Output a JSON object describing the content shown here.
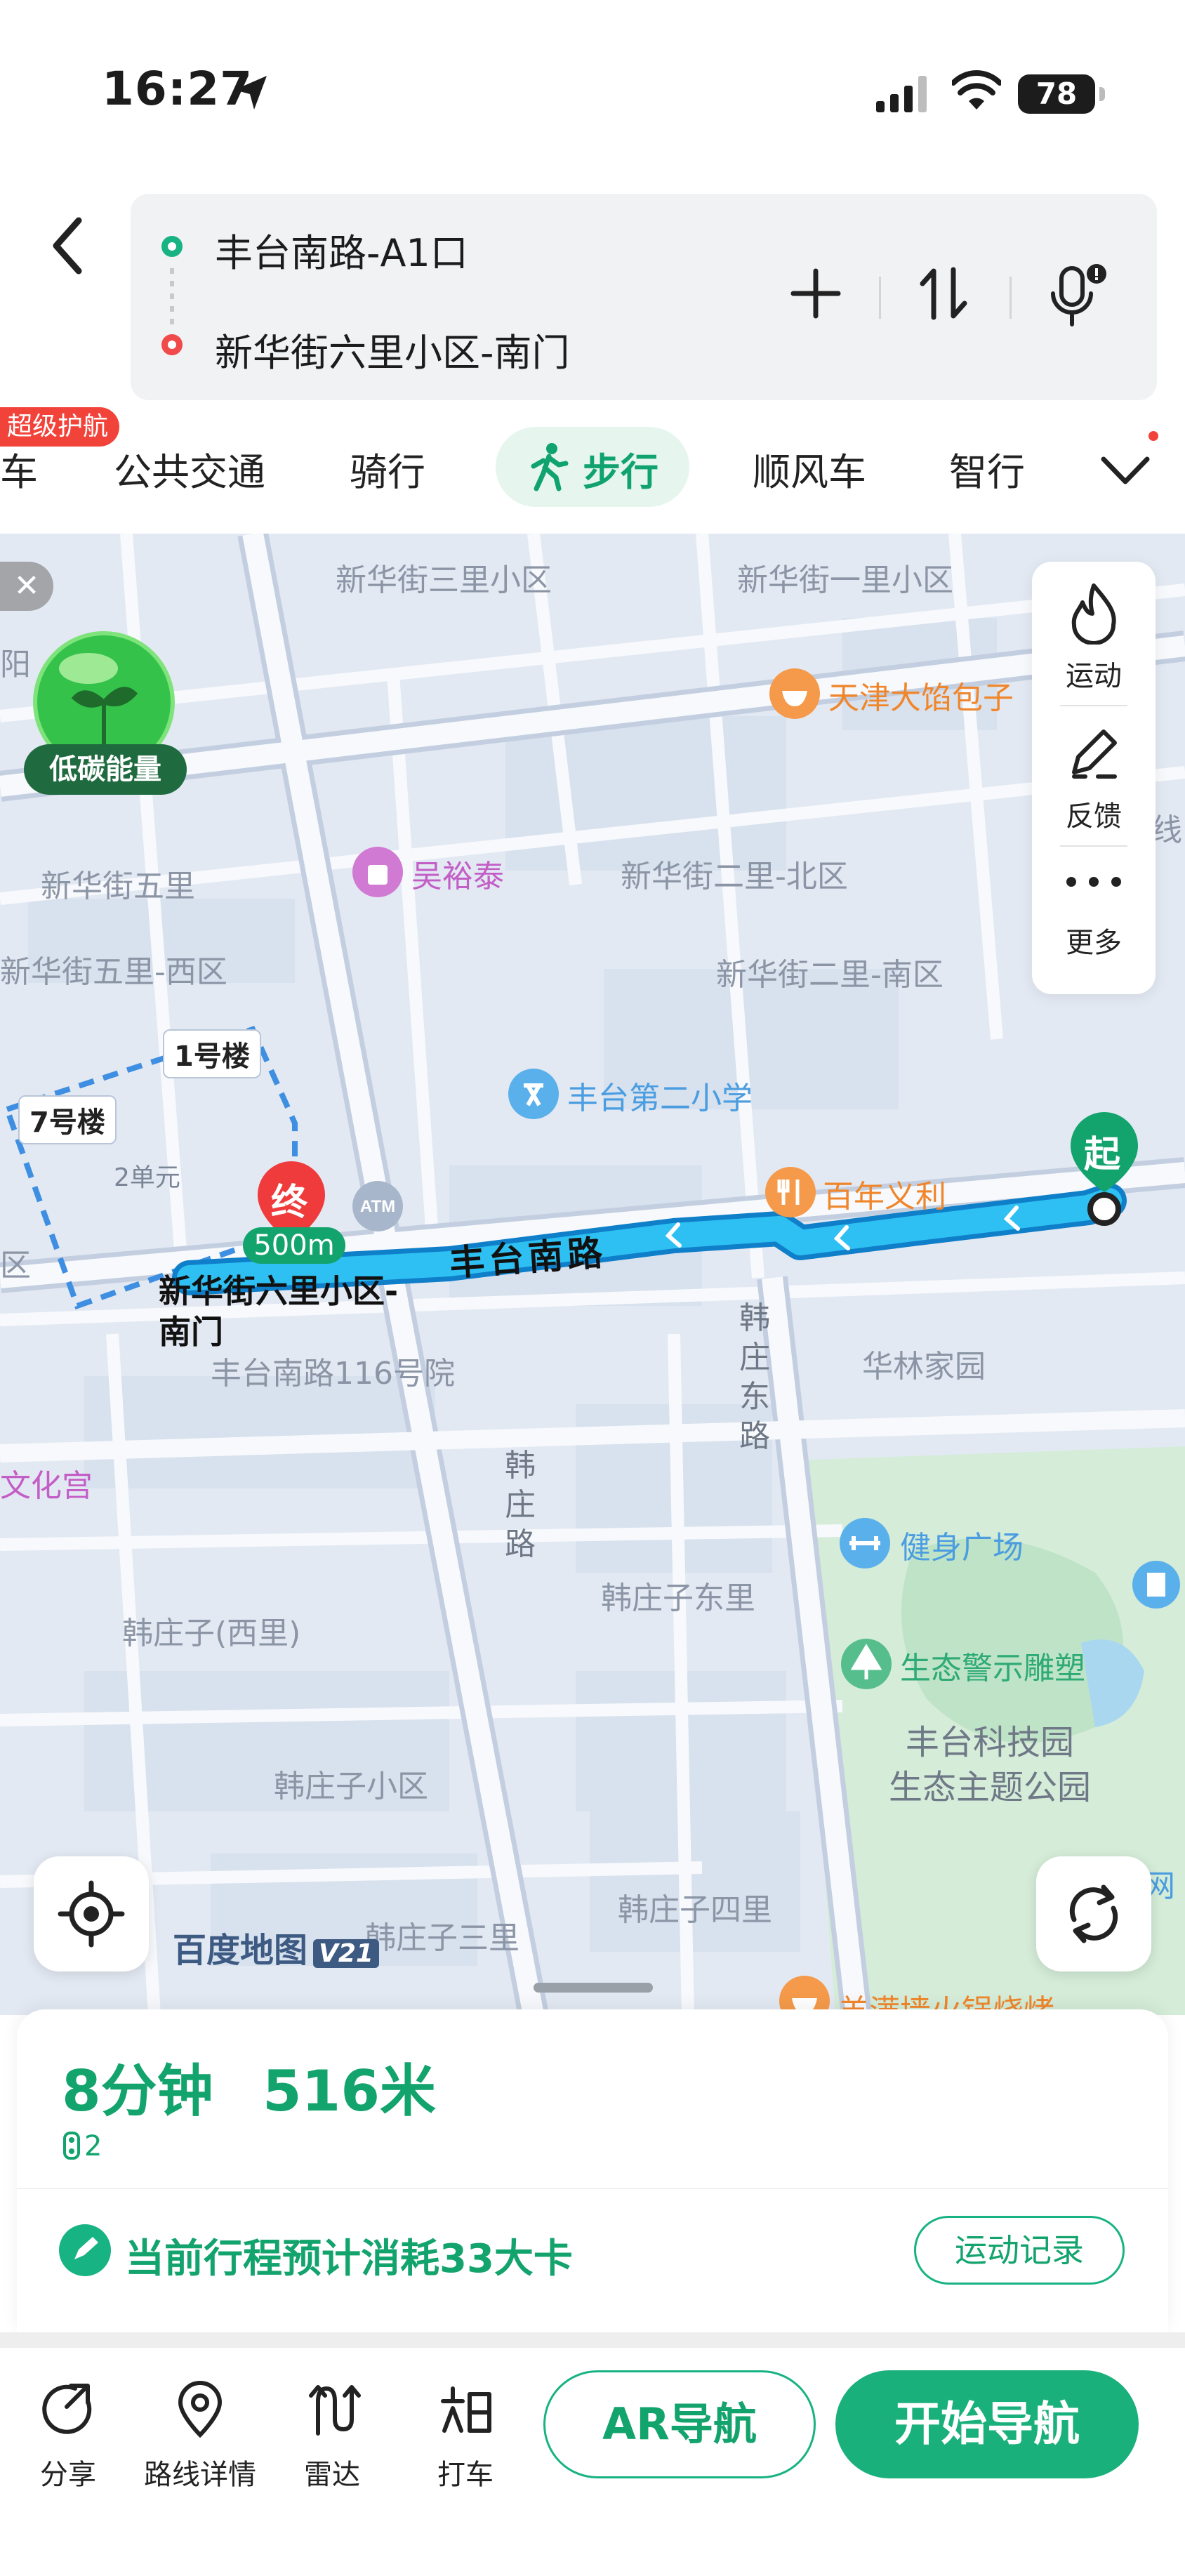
{
  "status_bar": {
    "time": "16:27",
    "battery": "78"
  },
  "route": {
    "start": "丰台南路-A1口",
    "end": "新华街六里小区-南门"
  },
  "modes": {
    "badge": "超级护航",
    "items": [
      "车",
      "公共交通",
      "骑行",
      "步行",
      "顺风车",
      "智行"
    ],
    "active": "步行"
  },
  "map": {
    "pois": {
      "p1": "新华街三里小区",
      "p2": "新华街一里小区",
      "p3": "天津大馅包子",
      "p4": "吴裕泰",
      "p5": "新华街二里-北区",
      "p6": "新华街五里",
      "p7": "新华街五里-西区",
      "p8": "新华街二里-南区",
      "p9": "丰台第二小学",
      "p10": "百年义利",
      "p11": "华林家园",
      "p12": "丰台南路116号院",
      "p13": "文化宫",
      "p14": "健身广场",
      "p15": "韩庄子东里",
      "p16": "韩庄子(西里)",
      "p17": "生态警示雕塑",
      "p18": "丰台科技园\n生态主题公园",
      "p19": "韩庄子小区",
      "p20": "韩庄子三里",
      "p21": "韩庄子四里",
      "p22": "羊满墙火锅烧烤",
      "p23": "阳",
      "p24": "区",
      "p25": "网",
      "p26": "2单元",
      "p27": "线"
    },
    "streets": {
      "main": "丰台南路",
      "east": "韩庄东路",
      "west": "韩庄路"
    },
    "buildings": {
      "b1": "1号楼",
      "b2": "7号楼"
    },
    "start_pin": "起",
    "end_pin": "终",
    "end_distance": "500m",
    "end_label": "新华街六里小区-\n南门",
    "energy_label": "低碳能量",
    "logo": "百度地图",
    "logo_version": "V21",
    "side_panel": {
      "sport": "运动",
      "feedback": "反馈",
      "more": "更多"
    }
  },
  "summary": {
    "eta": "8分钟",
    "distance": "516米",
    "lights": "2",
    "calories": "当前行程预计消耗33大卡",
    "record_button": "运动记录"
  },
  "actions": {
    "share": "分享",
    "route_detail": "路线详情",
    "radar": "雷达",
    "taxi": "打车",
    "ar_nav": "AR导航",
    "start_nav": "开始导航"
  },
  "colors": {
    "accent": "#19b07c",
    "route": "#2aa9f0",
    "danger": "#f04a4a"
  }
}
